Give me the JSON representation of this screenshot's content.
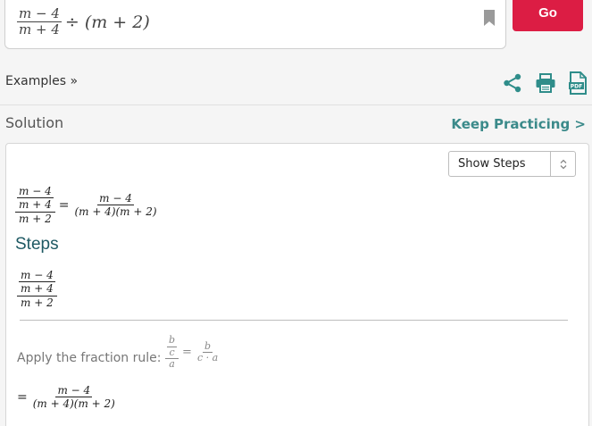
{
  "input": {
    "numerator": "m − 4",
    "denominator": "m + 4",
    "rest": "÷ (m + 2)"
  },
  "go_label": "Go",
  "examples_label": "Examples »",
  "solution_label": "Solution",
  "keep_practicing_label": "Keep Practicing >",
  "steps_select": {
    "selected": "Show Steps"
  },
  "result": {
    "lhs_inner_num": "m − 4",
    "lhs_inner_den": "m + 4",
    "lhs_outer_den": "m + 2",
    "equals": "=",
    "rhs_num": "m − 4",
    "rhs_den": "(m + 4)(m + 2)"
  },
  "steps_heading": "Steps",
  "steps_expr": {
    "inner_num": "m − 4",
    "inner_den": "m + 4",
    "outer_den": "m + 2"
  },
  "rule": {
    "label": "Apply the fraction rule:",
    "b": "b",
    "c": "c",
    "a": "a",
    "equals": "=",
    "rhs_num": "b",
    "rhs_den": "c · a"
  },
  "final": {
    "equals": "=",
    "num": "m − 4",
    "den": "(m + 4)(m + 2)"
  },
  "colors": {
    "go_button": "#dc1d44",
    "accent_teal": "#3b8a8a",
    "steps_heading": "#1e5963"
  },
  "icons": [
    "bookmark-icon",
    "share-icon",
    "print-icon",
    "pdf-icon",
    "select-arrows-icon"
  ]
}
